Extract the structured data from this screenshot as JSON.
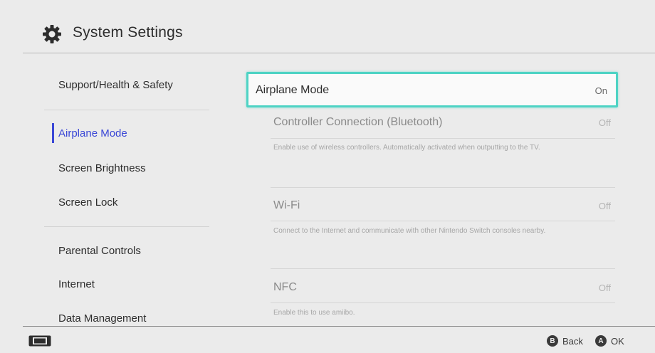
{
  "header": {
    "title": "System Settings",
    "icon": "gear-icon"
  },
  "sidebar": {
    "items": [
      {
        "label": "Support/Health & Safety",
        "active": false
      },
      {
        "label": "Airplane Mode",
        "active": true
      },
      {
        "label": "Screen Brightness",
        "active": false
      },
      {
        "label": "Screen Lock",
        "active": false
      },
      {
        "label": "Parental Controls",
        "active": false
      },
      {
        "label": "Internet",
        "active": false
      },
      {
        "label": "Data Management",
        "active": false
      }
    ]
  },
  "panel": {
    "selected": {
      "label": "Airplane Mode",
      "value": "On"
    },
    "options": [
      {
        "label": "Controller Connection (Bluetooth)",
        "value": "Off",
        "description": "Enable use of wireless controllers. Automatically activated when outputting to the TV."
      },
      {
        "label": "Wi-Fi",
        "value": "Off",
        "description": "Connect to the Internet and communicate with other Nintendo Switch consoles nearby."
      },
      {
        "label": "NFC",
        "value": "Off",
        "description": "Enable this to use amiibo."
      }
    ]
  },
  "footer": {
    "console_icon": "console-icon",
    "back": {
      "glyph": "B",
      "label": "Back"
    },
    "ok": {
      "glyph": "A",
      "label": "OK"
    }
  },
  "colors": {
    "accent": "#3a47d6",
    "selection": "#4ed3c4",
    "background": "#ebebeb"
  }
}
